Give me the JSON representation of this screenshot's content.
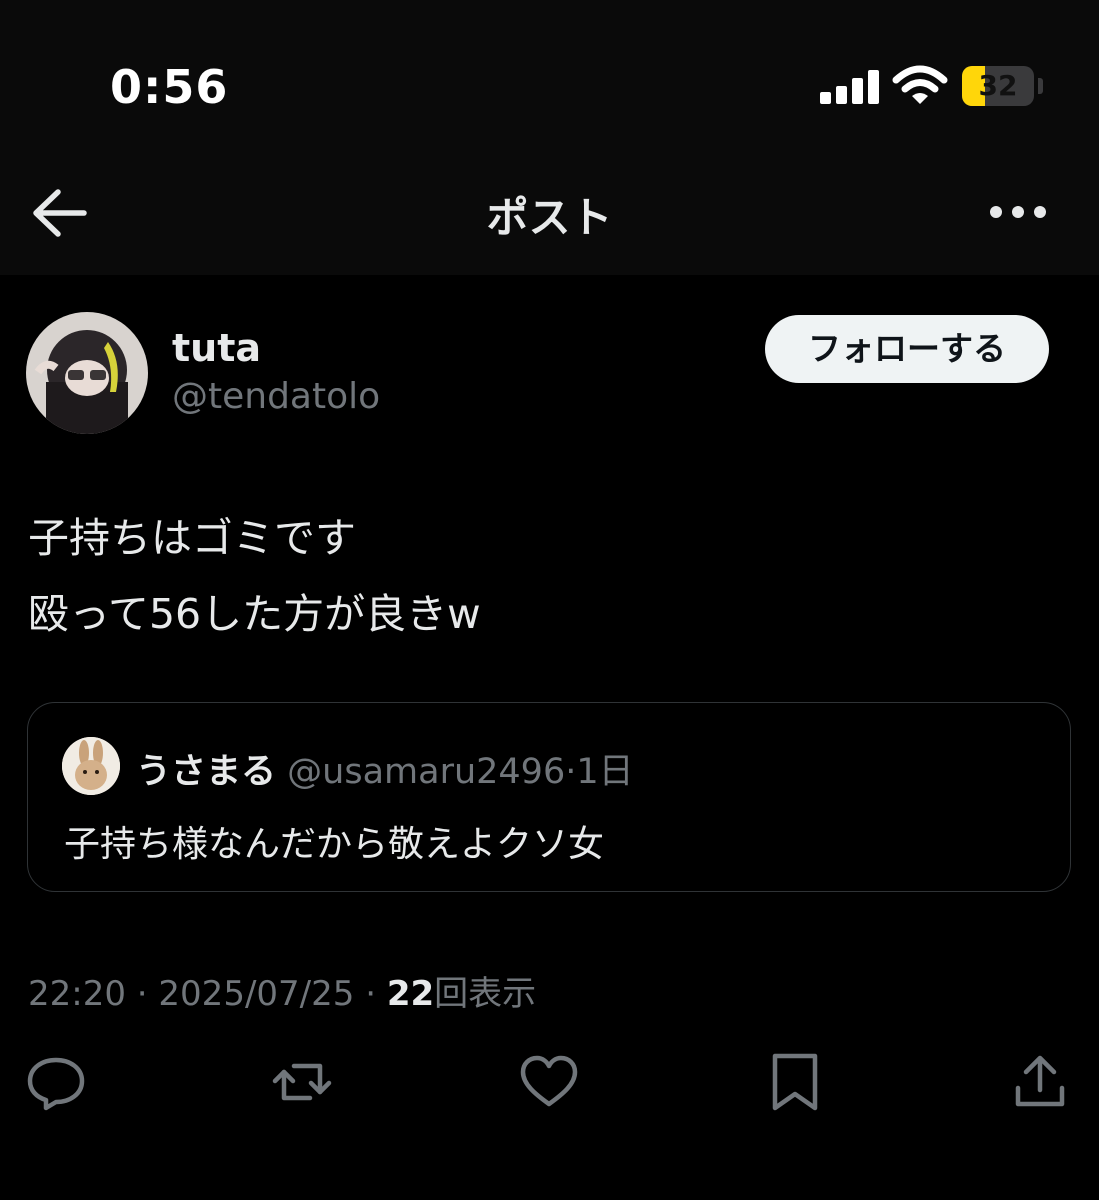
{
  "status_bar": {
    "time": "0:56",
    "battery": "32",
    "battery_level": 0.32,
    "signal_icon": "cellular-signal-icon",
    "wifi_icon": "wifi-icon",
    "battery_color": "#ffd60a"
  },
  "nav": {
    "title": "ポスト",
    "back_icon": "back-arrow-icon",
    "more_icon": "more-horizontal-icon"
  },
  "author": {
    "display_name": "tuta",
    "handle": "@tendatolo",
    "follow_label": "フォローする"
  },
  "post": {
    "lines": [
      "子持ちはゴミです",
      "殴って56した方が良きw"
    ]
  },
  "quote": {
    "display_name": "うさまる",
    "handle": "@usamaru2496",
    "separator": "·",
    "time": "1日",
    "text": "子持ち様なんだから敬えよクソ女"
  },
  "meta": {
    "time": "22:20",
    "sep1": "·",
    "date": "2025/07/25",
    "sep2": "·",
    "views_count": "22",
    "views_label": "回表示"
  },
  "actions": [
    {
      "icon": "reply-icon"
    },
    {
      "icon": "repost-icon"
    },
    {
      "icon": "like-icon"
    },
    {
      "icon": "bookmark-icon"
    },
    {
      "icon": "share-icon"
    }
  ],
  "colors": {
    "background": "#000000",
    "text_primary": "#e7e9ea",
    "text_secondary": "#71767b",
    "border": "#2f3336",
    "button_bg": "#eff3f4"
  }
}
